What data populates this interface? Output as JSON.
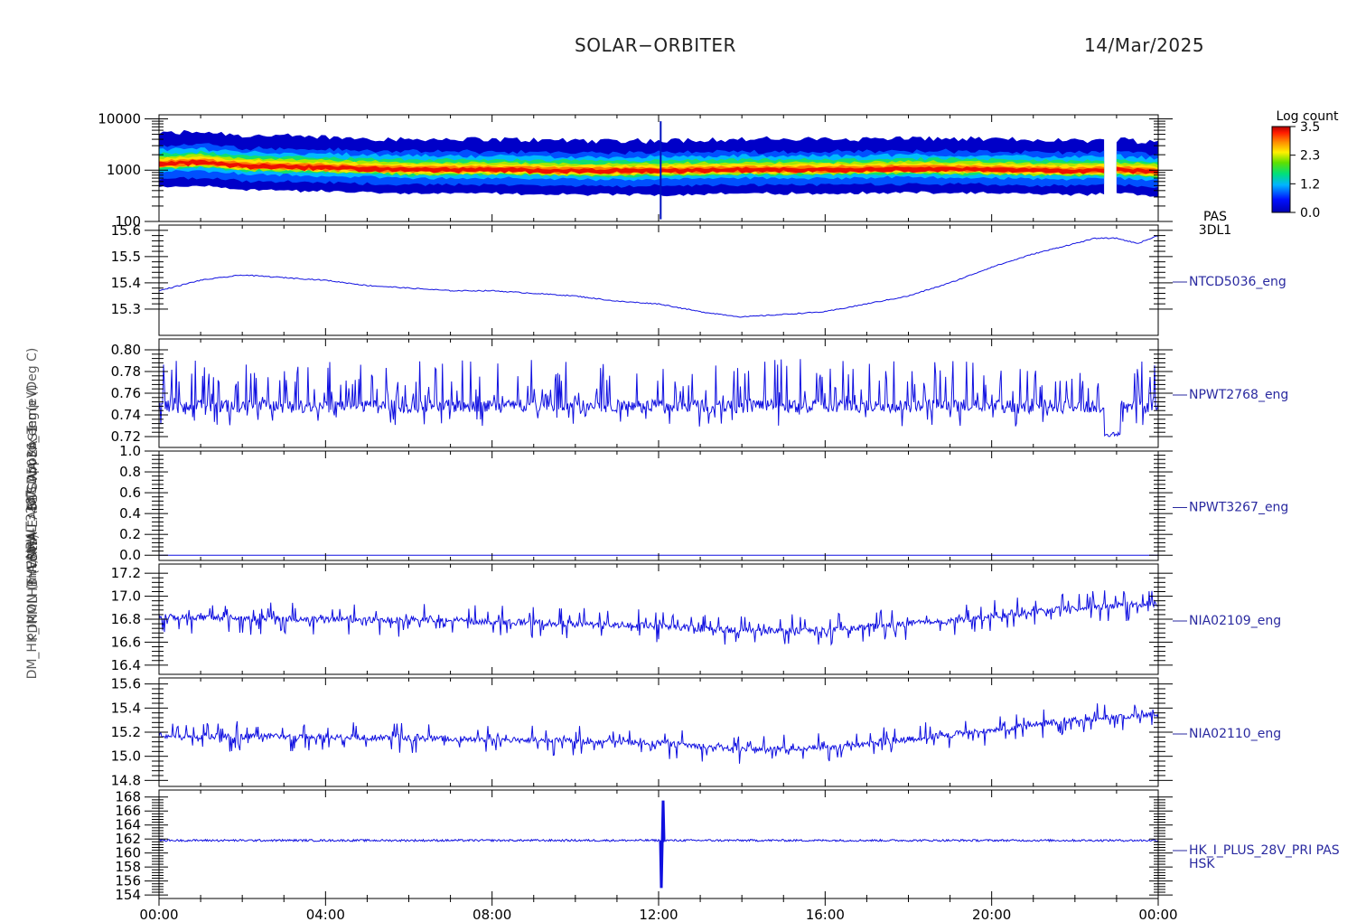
{
  "header": {
    "title": "SOLAR−ORBITER",
    "date": "14/Mar/2025"
  },
  "y_axis_label_overlap": "(mA) DM_HK_IMON_PDRMLHB_(Volts) THERMAL_1 (Amps)",
  "y_axis_labels_stacked": [
    "(eV)",
    "EAS Approx Temp (Deg C)",
    "NTCD5036_eng",
    "SWA-EAS1-SWA-EAS1",
    "NPWT3267",
    "THERMAL",
    "PDRMLHB (Volts)",
    "DM_HK_IMON (mA)"
  ],
  "colors": {
    "trace": "#1010e0",
    "axis": "#000000",
    "label": "#2a2aa0"
  },
  "chart_data": [
    {
      "type": "heatmap",
      "panel_label": "PAS\n3DL1",
      "label_line1": "PAS",
      "label_line2": "3DL1",
      "ylabel": "(eV)",
      "yscale": "log",
      "ylim": [
        100,
        12000
      ],
      "yticks": [
        100,
        1000,
        10000
      ],
      "yticklabels": [
        "100",
        "1000",
        "10000"
      ],
      "colorbar": {
        "title": "Log count",
        "ticks": [
          "3.5",
          "2.3",
          "1.2",
          "0.0"
        ],
        "range": [
          0.0,
          3.5
        ]
      },
      "peak_energy_ev": [
        [
          0.0,
          1300
        ],
        [
          1.0,
          1400
        ],
        [
          2.0,
          1200
        ],
        [
          4.0,
          1100
        ],
        [
          6.0,
          1000
        ],
        [
          8.0,
          1000
        ],
        [
          10.0,
          950
        ],
        [
          12.0,
          950
        ],
        [
          14.0,
          1000
        ],
        [
          16.0,
          1000
        ],
        [
          18.0,
          1050
        ],
        [
          20.0,
          1000
        ],
        [
          22.0,
          950
        ],
        [
          23.0,
          1000
        ],
        [
          24.0,
          900
        ]
      ],
      "data_gaps_hours": [
        [
          12.05,
          12.1
        ],
        [
          22.75,
          23.0
        ]
      ]
    },
    {
      "type": "line",
      "series_name": "NTCD5036_eng",
      "ylim": [
        15.2,
        15.62
      ],
      "yticks": [
        15.3,
        15.4,
        15.5,
        15.6
      ],
      "yticklabels": [
        "15.3",
        "15.4",
        "15.5",
        "15.6"
      ],
      "x": [
        0,
        1,
        2,
        3,
        4,
        5,
        6,
        7,
        8,
        9,
        10,
        11,
        12,
        13,
        14,
        15,
        16,
        17,
        18,
        19,
        20,
        21,
        22,
        22.5,
        23,
        23.5,
        24
      ],
      "y": [
        15.37,
        15.41,
        15.43,
        15.42,
        15.41,
        15.39,
        15.38,
        15.37,
        15.37,
        15.36,
        15.35,
        15.33,
        15.32,
        15.29,
        15.27,
        15.28,
        15.29,
        15.32,
        15.35,
        15.4,
        15.46,
        15.51,
        15.55,
        15.57,
        15.57,
        15.55,
        15.58
      ],
      "noise": 0.004
    },
    {
      "type": "line",
      "series_name": "NPWT2768_eng",
      "ylim": [
        0.71,
        0.81
      ],
      "yticks": [
        0.72,
        0.74,
        0.76,
        0.78,
        0.8
      ],
      "yticklabels": [
        "0.72",
        "0.74",
        "0.76",
        "0.78",
        "0.80"
      ],
      "baseline": 0.748,
      "spike_range": [
        0.735,
        0.8
      ],
      "dip_hours": [
        22.7,
        23.1
      ],
      "dip_value": 0.722
    },
    {
      "type": "line",
      "series_name": "NPWT3267_eng",
      "ylim": [
        -0.05,
        1.0
      ],
      "yticks": [
        0.0,
        0.2,
        0.4,
        0.6,
        0.8,
        1.0
      ],
      "yticklabels": [
        "0.0",
        "0.2",
        "0.4",
        "0.6",
        "0.8",
        "1.0"
      ],
      "x": [
        0,
        24
      ],
      "y": [
        0.0,
        0.0
      ]
    },
    {
      "type": "line",
      "series_name": "NIA02109_eng",
      "ylim": [
        16.32,
        17.28
      ],
      "yticks": [
        16.4,
        16.6,
        16.8,
        17.0,
        17.2
      ],
      "yticklabels": [
        "16.4",
        "16.6",
        "16.8",
        "17.0",
        "17.2"
      ],
      "x": [
        0,
        4,
        8,
        12,
        14,
        16,
        18,
        20,
        22,
        24
      ],
      "y": [
        16.82,
        16.8,
        16.78,
        16.74,
        16.7,
        16.7,
        16.76,
        16.82,
        16.9,
        16.94
      ],
      "noise": 0.09
    },
    {
      "type": "line",
      "series_name": "NIA02110_eng",
      "ylim": [
        14.75,
        15.65
      ],
      "yticks": [
        14.8,
        15.0,
        15.2,
        15.4,
        15.6
      ],
      "yticklabels": [
        "14.8",
        "15.0",
        "15.2",
        "15.4",
        "15.6"
      ],
      "x": [
        0,
        4,
        8,
        12,
        14,
        16,
        18,
        20,
        22,
        24
      ],
      "y": [
        15.17,
        15.16,
        15.14,
        15.11,
        15.06,
        15.07,
        15.14,
        15.22,
        15.3,
        15.35
      ],
      "noise": 0.08
    },
    {
      "type": "line",
      "series_name": "HK_I_PLUS_28V_PRI PAS",
      "series_name_line2": "HSK",
      "ylim": [
        153.5,
        169.0
      ],
      "yticks": [
        154,
        156,
        158,
        160,
        162,
        164,
        166,
        168
      ],
      "yticklabels": [
        "154",
        "156",
        "158",
        "160",
        "162",
        "164",
        "166",
        "168"
      ],
      "baseline": 161.8,
      "noise": 0.15,
      "spike_hour": 12.05,
      "spike_min": 155.0,
      "spike_max": 167.5
    }
  ],
  "x_axis": {
    "range_hours": [
      0,
      24
    ],
    "ticks_hours": [
      0,
      4,
      8,
      12,
      16,
      20,
      24
    ],
    "ticklabels": [
      "00:00",
      "04:00",
      "08:00",
      "12:00",
      "16:00",
      "20:00",
      "00:00"
    ]
  }
}
